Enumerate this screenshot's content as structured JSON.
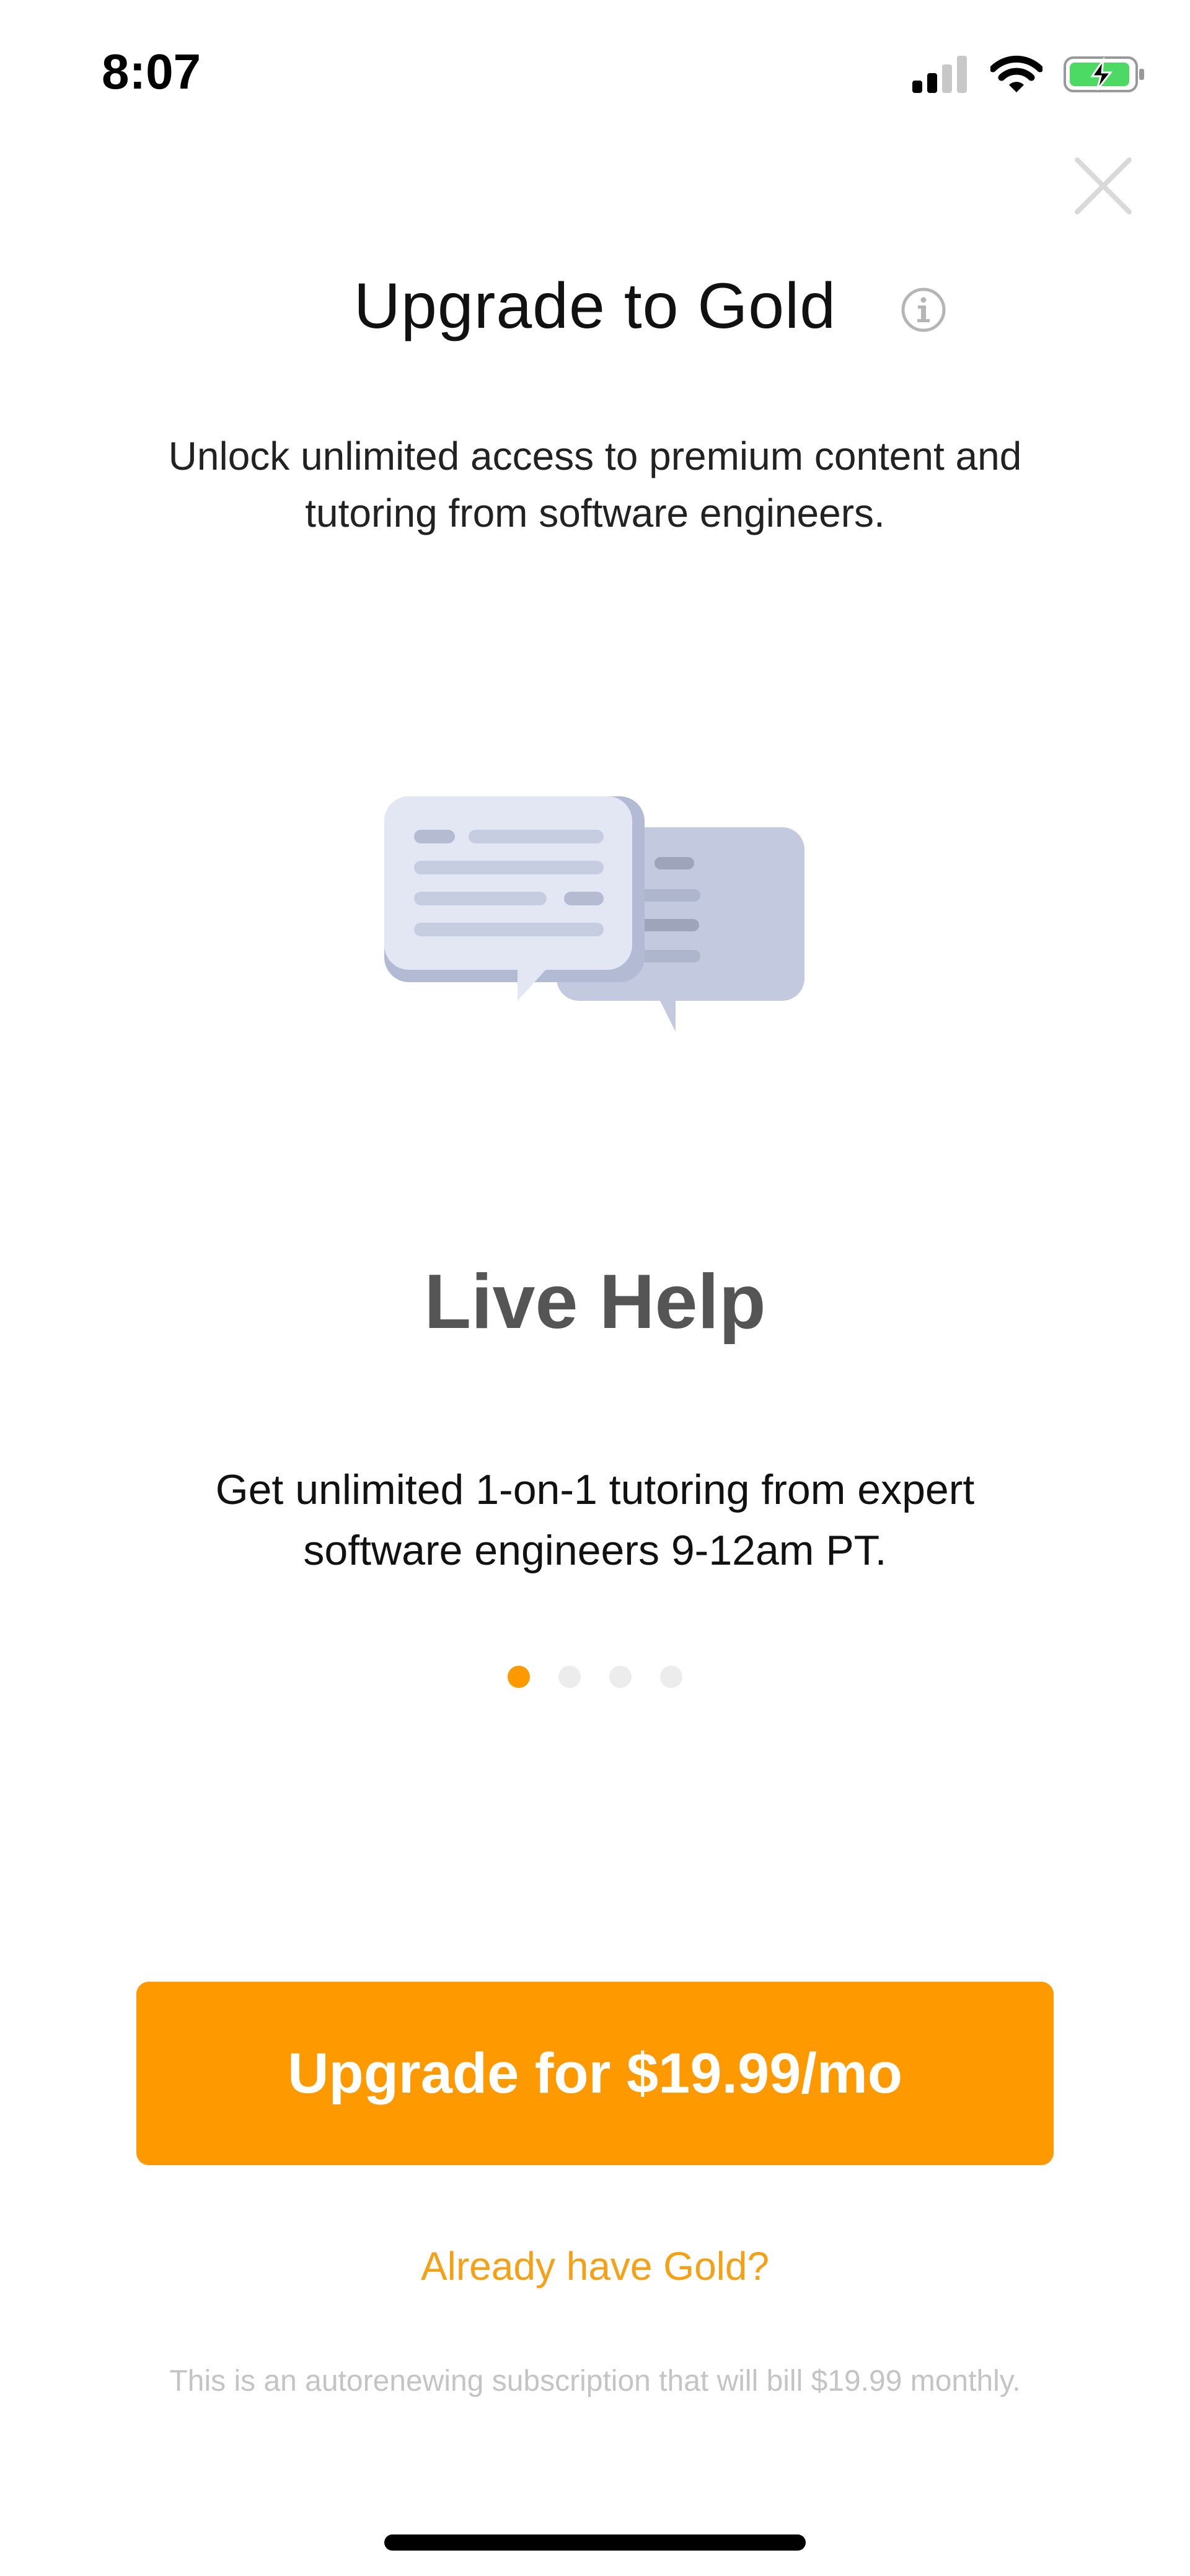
{
  "status_bar": {
    "time": "8:07"
  },
  "header": {
    "title": "Upgrade to Gold",
    "subtitle": "Unlock unlimited access to premium content and tutoring from software engineers."
  },
  "feature": {
    "title": "Live Help",
    "description": "Get unlimited 1-on-1 tutoring from expert software engineers 9-12am PT.",
    "illustration_icon": "chat-bubbles-icon"
  },
  "pager": {
    "total": 4,
    "active_index": 0
  },
  "actions": {
    "upgrade_label": "Upgrade for $19.99/mo",
    "already_label": "Already have Gold?"
  },
  "footer": {
    "disclaimer": "This is an autorenewing subscription that will bill $19.99 monthly."
  },
  "colors": {
    "accent": "#ff9900",
    "link": "#f5a118",
    "dot_inactive": "#ececec"
  }
}
